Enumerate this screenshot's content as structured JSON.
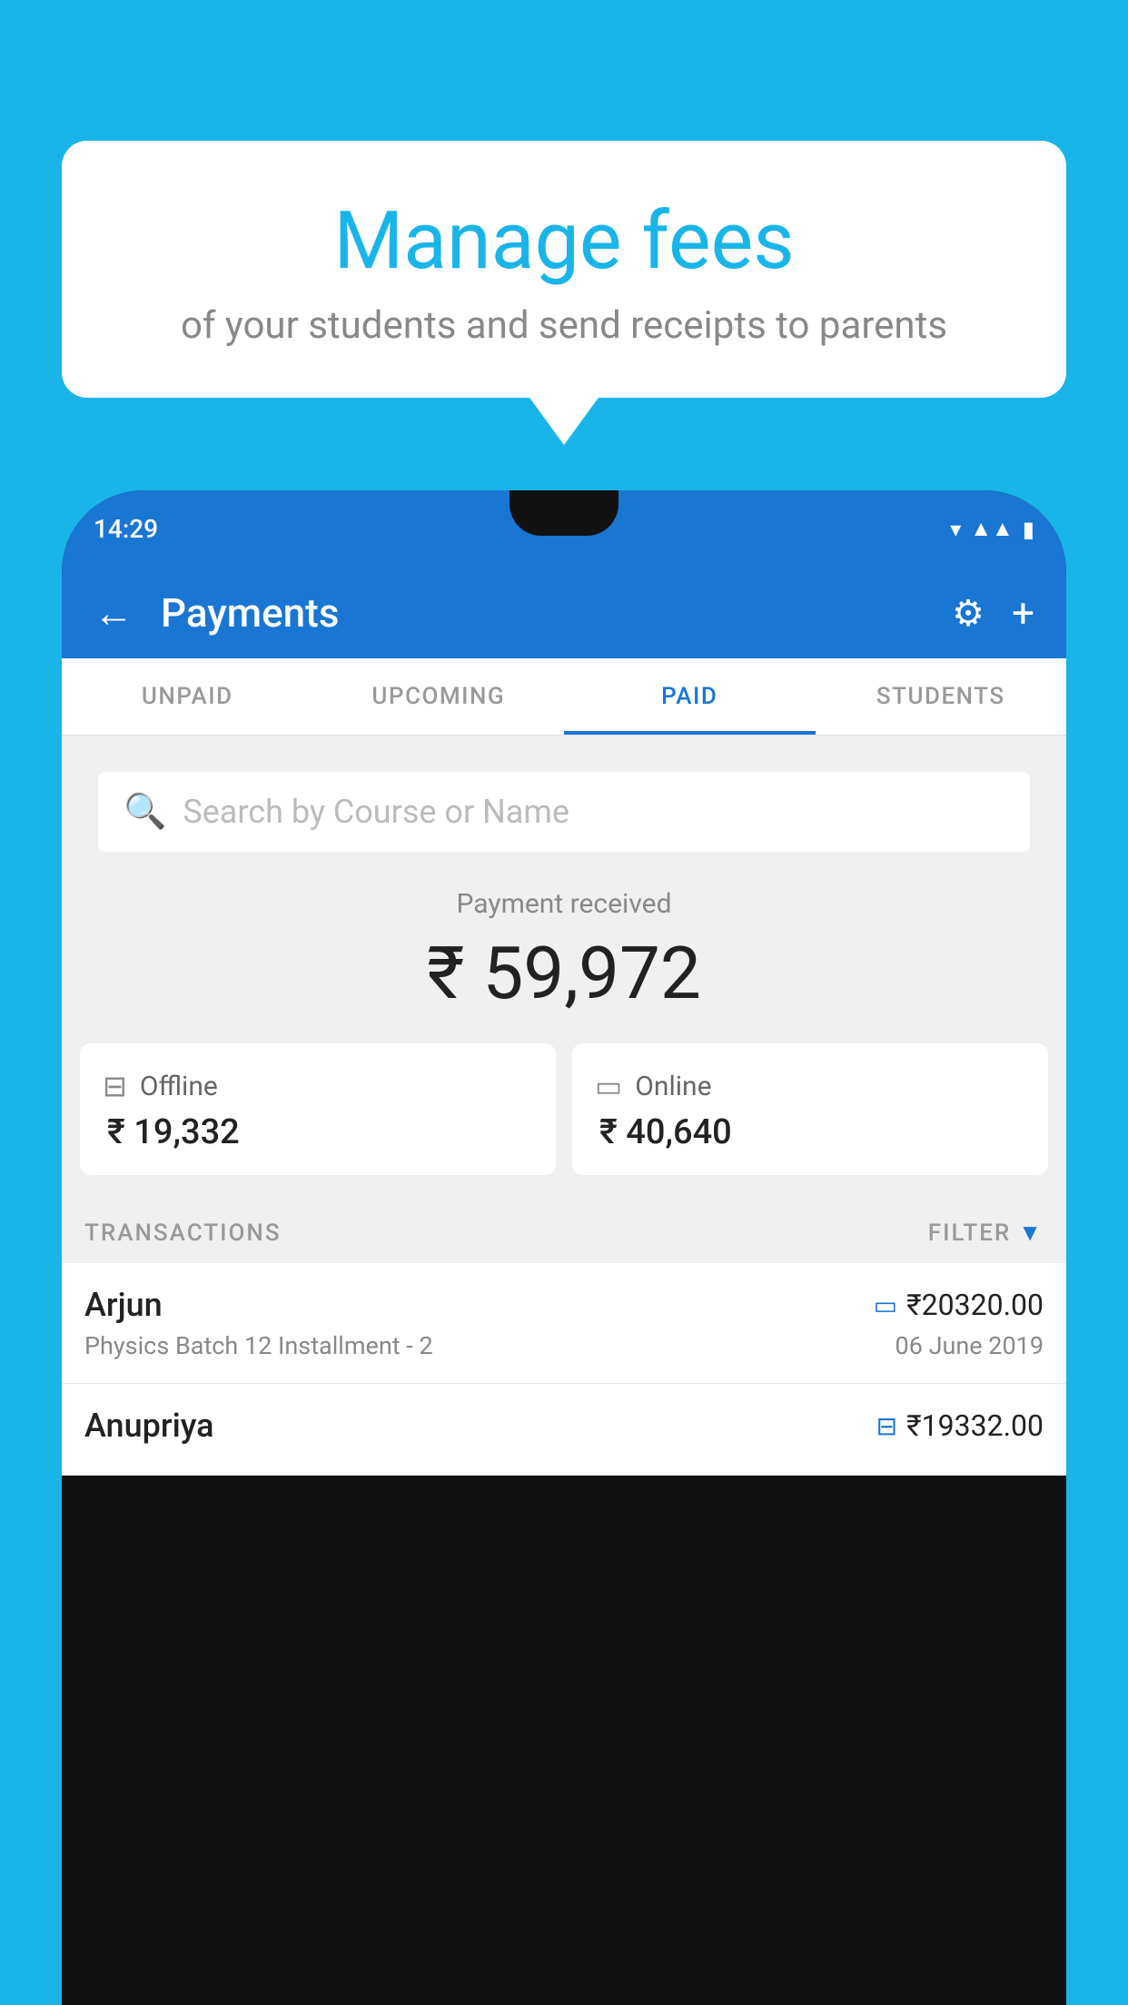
{
  "background_color": "#1ab5e8",
  "bubble": {
    "title": "Manage fees",
    "subtitle": "of your students and send receipts to parents"
  },
  "phone": {
    "status_bar": {
      "time": "14:29"
    },
    "header": {
      "title": "Payments",
      "back_label": "←",
      "gear_label": "⚙",
      "plus_label": "+"
    },
    "tabs": [
      {
        "label": "UNPAID",
        "active": false
      },
      {
        "label": "UPCOMING",
        "active": false
      },
      {
        "label": "PAID",
        "active": true
      },
      {
        "label": "STUDENTS",
        "active": false
      }
    ],
    "search": {
      "placeholder": "Search by Course or Name"
    },
    "payment_summary": {
      "label": "Payment received",
      "amount": "₹ 59,972"
    },
    "cards": [
      {
        "icon": "offline-payment-icon",
        "label": "Offline",
        "amount": "₹ 19,332"
      },
      {
        "icon": "online-payment-icon",
        "label": "Online",
        "amount": "₹ 40,640"
      }
    ],
    "transactions": {
      "header_label": "TRANSACTIONS",
      "filter_label": "FILTER",
      "items": [
        {
          "name": "Arjun",
          "amount": "₹20320.00",
          "detail": "Physics Batch 12 Installment - 2",
          "date": "06 June 2019",
          "payment_type": "online"
        },
        {
          "name": "Anupriya",
          "amount": "₹19332.00",
          "detail": "",
          "date": "",
          "payment_type": "offline"
        }
      ]
    }
  }
}
